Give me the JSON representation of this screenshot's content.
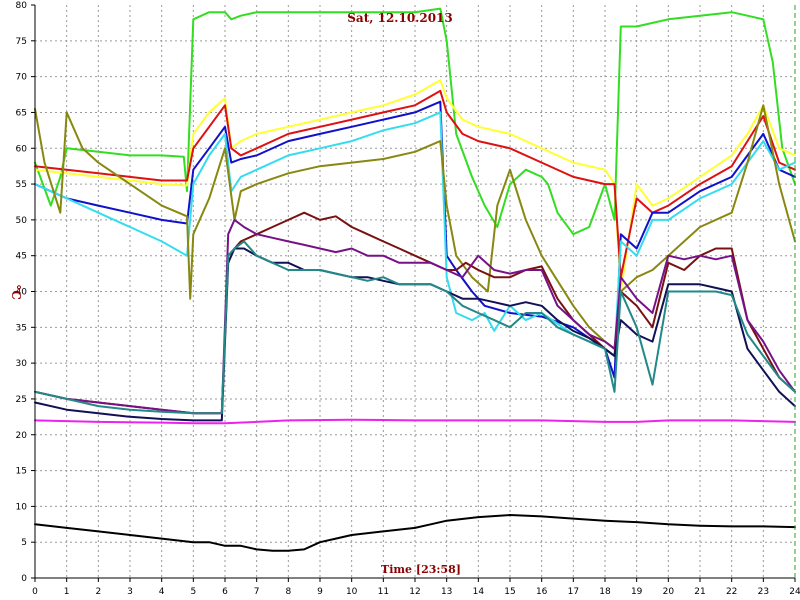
{
  "chart_data": {
    "type": "line",
    "title": "Sat, 12.10.2013",
    "xlabel": "Time [23:58]",
    "ylabel": "°C",
    "xlim": [
      0,
      24
    ],
    "ylim": [
      0,
      80
    ],
    "xticks": [
      "0",
      "1",
      "2",
      "3",
      "4",
      "5",
      "6",
      "7",
      "8",
      "9",
      "10",
      "11",
      "12",
      "13",
      "14",
      "15",
      "16",
      "17",
      "18",
      "19",
      "20",
      "21",
      "22",
      "23",
      "24"
    ],
    "yticks": [
      "0",
      "5",
      "10",
      "15",
      "20",
      "25",
      "30",
      "35",
      "40",
      "45",
      "50",
      "55",
      "60",
      "65",
      "70",
      "75",
      "80"
    ],
    "grid": true,
    "series": [
      {
        "color": "#33dd22",
        "x": [
          0,
          0.5,
          0.8,
          1,
          2,
          3,
          4,
          4.7,
          4.8,
          5,
          5.5,
          6,
          6.2,
          6.5,
          7,
          8,
          9,
          10,
          11,
          12,
          12.8,
          13,
          13.3,
          13.8,
          14.2,
          14.6,
          15,
          15.5,
          16,
          16.2,
          16.5,
          17,
          17.5,
          18,
          18.3,
          18.5,
          19,
          19.5,
          20,
          21,
          22,
          22.5,
          23,
          23.3,
          23.6,
          24
        ],
        "y": [
          58,
          52,
          56,
          60,
          59.5,
          59,
          59,
          58.8,
          54,
          78,
          79,
          79,
          78,
          78.5,
          79,
          79,
          79,
          79,
          79,
          79,
          79.5,
          75,
          62,
          56,
          52,
          49,
          55,
          57,
          56,
          55,
          51,
          48,
          49,
          55,
          50,
          77,
          77,
          77.5,
          78,
          78.5,
          79,
          78.5,
          78,
          72,
          60,
          55
        ]
      },
      {
        "color": "#ffff33",
        "x": [
          0,
          1,
          2,
          3,
          4,
          4.8,
          5,
          5.5,
          6,
          6.2,
          6.5,
          7,
          8,
          9,
          10,
          11,
          12,
          12.8,
          13,
          13.5,
          14,
          15,
          16,
          17,
          18,
          18.3,
          18.5,
          19,
          19.5,
          20,
          21,
          22,
          22.5,
          23,
          23.5,
          24
        ],
        "y": [
          57,
          56.5,
          56,
          55.5,
          55,
          54.8,
          62,
          65,
          67,
          60,
          61,
          62,
          63,
          64,
          65,
          66,
          67.5,
          69.5,
          67,
          64,
          63,
          62,
          60,
          58,
          57,
          55,
          40,
          55,
          52,
          53,
          56,
          59,
          62,
          66,
          60,
          59
        ]
      },
      {
        "color": "#dd1111",
        "x": [
          0,
          1,
          2,
          3,
          4,
          4.8,
          5,
          5.5,
          6,
          6.2,
          6.5,
          7,
          8,
          9,
          10,
          11,
          12,
          12.8,
          13,
          13.5,
          14,
          15,
          16,
          17,
          18,
          18.3,
          18.5,
          19,
          19.5,
          20,
          21,
          22,
          22.5,
          23,
          23.5,
          24
        ],
        "y": [
          57.5,
          57,
          56.5,
          56,
          55.5,
          55.5,
          60,
          63,
          66,
          60,
          59,
          60,
          62,
          63,
          64,
          65,
          66,
          68,
          65,
          62,
          61,
          60,
          58,
          56,
          55,
          55,
          42,
          53,
          51,
          52,
          55,
          57.5,
          61,
          64.5,
          58,
          57
        ]
      },
      {
        "color": "#1111cc",
        "x": [
          0,
          1,
          2,
          3,
          4,
          4.8,
          5,
          5.5,
          6,
          6.2,
          6.5,
          7,
          8,
          9,
          10,
          11,
          12,
          12.8,
          13,
          13.3,
          13.8,
          14.2,
          15,
          16,
          17,
          18,
          18.3,
          18.5,
          19,
          19.5,
          20,
          21,
          22,
          22.5,
          23,
          23.5,
          24
        ],
        "y": [
          55,
          53,
          52,
          51,
          50,
          49.5,
          57,
          60,
          63,
          58,
          58.5,
          59,
          61,
          62,
          63,
          64,
          65,
          66.5,
          45,
          43,
          40,
          38,
          37,
          36.5,
          35,
          32,
          28,
          48,
          46,
          51,
          51,
          54,
          56,
          59,
          62,
          57,
          56
        ]
      },
      {
        "color": "#33ddee",
        "x": [
          0,
          1,
          2,
          3,
          4,
          4.8,
          5,
          5.5,
          6,
          6.2,
          6.5,
          7,
          8,
          9,
          10,
          11,
          12,
          12.8,
          13,
          13.3,
          13.8,
          14.2,
          14.5,
          15,
          15.5,
          16,
          17,
          18,
          18.3,
          18.5,
          19,
          19.5,
          20,
          21,
          22,
          22.5,
          23,
          23.5,
          24
        ],
        "y": [
          55,
          53,
          51,
          49,
          47,
          45,
          55,
          59,
          62,
          54,
          56,
          57,
          59,
          60,
          61,
          62.5,
          63.5,
          65,
          42,
          37,
          36,
          37,
          34.5,
          38,
          36,
          37,
          34,
          32,
          31,
          47,
          45,
          50,
          50,
          53,
          55,
          58,
          61,
          57,
          58
        ]
      },
      {
        "color": "#888811",
        "x": [
          0,
          0.3,
          0.8,
          1,
          1.5,
          2,
          3,
          4,
          4.8,
          4.9,
          5,
          5.5,
          6,
          6.3,
          6.5,
          7,
          8,
          9,
          10,
          11,
          12,
          12.8,
          13,
          13.3,
          13.8,
          14.3,
          14.6,
          15,
          15.5,
          16,
          17,
          17.5,
          18,
          18.3,
          18.5,
          19,
          19.5,
          20,
          21,
          22,
          22.5,
          23,
          23.5,
          24
        ],
        "y": [
          65.5,
          58,
          51,
          65,
          60,
          58,
          55,
          52,
          50.5,
          39,
          48,
          53,
          60,
          50,
          54,
          55,
          56.5,
          57.5,
          58,
          58.5,
          59.5,
          61,
          52,
          45,
          42,
          40,
          52,
          57,
          50,
          45,
          38,
          35,
          33,
          32,
          40,
          42,
          43,
          45,
          49,
          51,
          58,
          66,
          55,
          47
        ]
      },
      {
        "color": "#7a1111",
        "x": [
          0,
          1,
          2,
          3,
          4,
          5,
          5.9,
          6.1,
          6.3,
          6.5,
          7,
          7.5,
          8,
          8.5,
          9,
          9.5,
          10,
          10.5,
          11,
          11.5,
          12,
          12.5,
          13,
          13.3,
          13.6,
          14,
          14.5,
          15,
          15.5,
          16,
          16.5,
          17,
          17.5,
          18,
          18.3,
          18.5,
          19,
          19.5,
          20,
          20.5,
          21,
          21.5,
          22,
          22.5,
          23,
          23.5,
          24
        ],
        "y": [
          26,
          25,
          24.5,
          24,
          23.5,
          23,
          23,
          45,
          46,
          47,
          48,
          49,
          50,
          51,
          50,
          50.5,
          49,
          48,
          47,
          46,
          45,
          44,
          43,
          43,
          44,
          43,
          42,
          42,
          43,
          43.5,
          39,
          36,
          34,
          32,
          31,
          40,
          38,
          35,
          44,
          43,
          45,
          46,
          46,
          36,
          32,
          28,
          26
        ]
      },
      {
        "color": "#771188",
        "x": [
          0,
          1,
          2,
          3,
          4,
          5,
          5.9,
          6.1,
          6.3,
          6.6,
          7,
          7.5,
          8,
          8.5,
          9,
          9.5,
          10,
          10.5,
          11,
          11.5,
          12,
          12.5,
          13,
          13.5,
          14,
          14.5,
          15,
          15.5,
          16,
          16.5,
          17,
          17.5,
          18,
          18.3,
          18.5,
          19,
          19.5,
          20,
          20.5,
          21,
          21.5,
          22,
          22.5,
          23,
          23.5,
          24
        ],
        "y": [
          26,
          25,
          24.5,
          24,
          23.5,
          23,
          23,
          48,
          50,
          49,
          48,
          47.5,
          47,
          46.5,
          46,
          45.5,
          46,
          45,
          45,
          44,
          44,
          44,
          43,
          42,
          45,
          43,
          42.5,
          43,
          43,
          38,
          36,
          34,
          33,
          32,
          42,
          39,
          37,
          45,
          44.5,
          45,
          44.5,
          45,
          36,
          33,
          29,
          26
        ]
      },
      {
        "color": "#111155",
        "x": [
          0,
          1,
          2,
          3,
          4,
          5,
          5.9,
          6.1,
          6.3,
          6.6,
          7,
          7.5,
          8,
          8.5,
          9,
          9.5,
          10,
          10.5,
          11,
          11.5,
          12,
          12.5,
          13,
          13.5,
          14,
          14.5,
          15,
          15.5,
          16,
          16.5,
          17,
          17.5,
          18,
          18.3,
          18.5,
          19,
          19.5,
          20,
          20.5,
          21,
          21.5,
          22,
          22.5,
          23,
          23.5,
          24
        ],
        "y": [
          24.5,
          23.5,
          23,
          22.5,
          22.2,
          22,
          22,
          44,
          46,
          46,
          45,
          44,
          44,
          43,
          43,
          42.5,
          42,
          42,
          41.5,
          41,
          41,
          41,
          40,
          39,
          39,
          38.5,
          38,
          38.5,
          38,
          36,
          34.5,
          33.5,
          32,
          31,
          36,
          34,
          33,
          41,
          41,
          41,
          40.5,
          40,
          32,
          29,
          26,
          24
        ]
      },
      {
        "color": "#228888",
        "x": [
          0,
          1,
          2,
          3,
          4,
          5,
          5.9,
          6.1,
          6.3,
          6.6,
          7,
          7.5,
          8,
          8.5,
          9,
          9.5,
          10,
          10.5,
          11,
          11.5,
          12,
          12.5,
          13,
          13.5,
          14,
          14.5,
          15,
          15.5,
          16,
          16.5,
          17,
          17.5,
          18,
          18.3,
          18.5,
          19,
          19.5,
          20,
          20.5,
          21,
          21.5,
          22,
          22.5,
          23,
          23.5,
          24
        ],
        "y": [
          26,
          25,
          24,
          23.5,
          23.2,
          23,
          23,
          45,
          46,
          47,
          45,
          44,
          43,
          43,
          43,
          42.5,
          42,
          41.5,
          42,
          41,
          41,
          41,
          40,
          38,
          37,
          36,
          35,
          37,
          37,
          35,
          34,
          33,
          32,
          26,
          40,
          35,
          27,
          40,
          40,
          40,
          40,
          39.5,
          34,
          31,
          28,
          26
        ]
      },
      {
        "color": "#ee22ee",
        "x": [
          0,
          2,
          4,
          5,
          6,
          7,
          8,
          10,
          12,
          14,
          16,
          18,
          19,
          20,
          22,
          24
        ],
        "y": [
          22,
          21.8,
          21.7,
          21.6,
          21.6,
          21.8,
          22,
          22.1,
          22,
          22,
          22,
          21.8,
          21.8,
          22,
          22,
          21.8
        ]
      },
      {
        "color": "#000000",
        "x": [
          0,
          1,
          2,
          3,
          4,
          5,
          5.5,
          6,
          6.5,
          7,
          7.5,
          8,
          8.5,
          9,
          9.5,
          10,
          11,
          12,
          12.5,
          13,
          14,
          15,
          16,
          17,
          18,
          19,
          20,
          21,
          22,
          23,
          24
        ],
        "y": [
          7.5,
          7,
          6.5,
          6,
          5.5,
          5,
          5,
          4.5,
          4.5,
          4,
          3.8,
          3.8,
          4,
          5,
          5.5,
          6,
          6.5,
          7,
          7.5,
          8,
          8.5,
          8.8,
          8.6,
          8.3,
          8,
          7.8,
          7.5,
          7.3,
          7.2,
          7.2,
          7.1
        ]
      }
    ]
  }
}
